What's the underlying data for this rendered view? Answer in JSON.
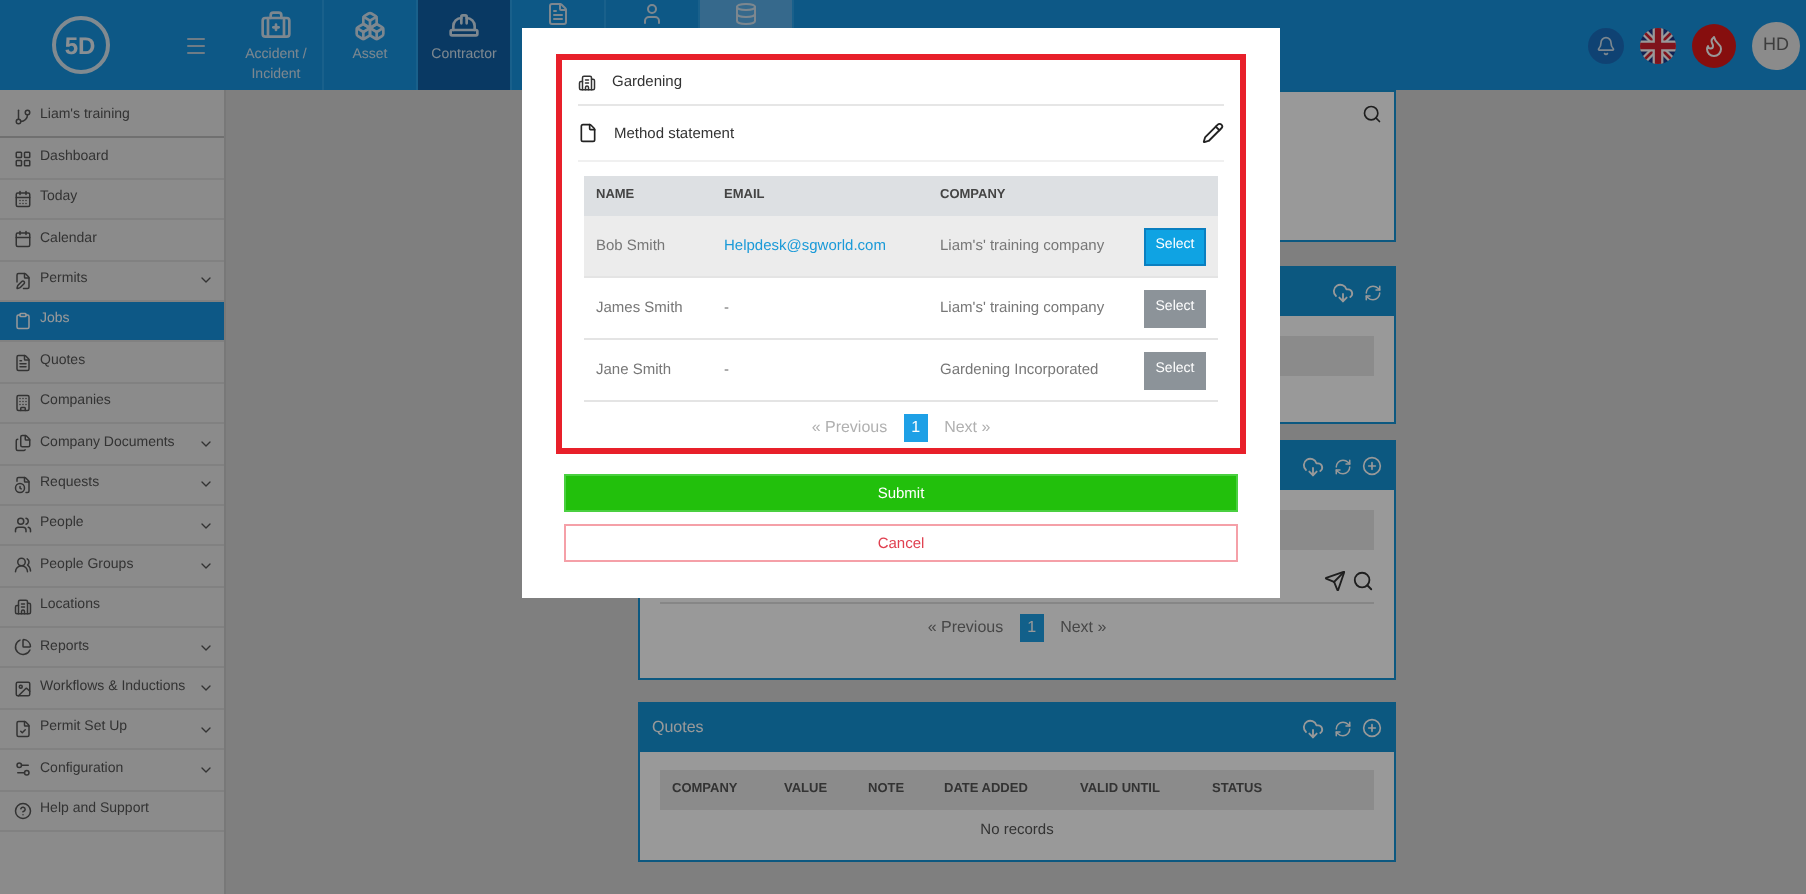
{
  "header": {
    "logo": "5D",
    "tabs": [
      {
        "label": "Accident / Incident",
        "selected": false
      },
      {
        "label": "Asset",
        "selected": false
      },
      {
        "label": "Contractor",
        "selected": true
      },
      {
        "selected": false
      },
      {
        "selected": false
      },
      {
        "selected": false
      }
    ],
    "avatar": "HD"
  },
  "sidebar": {
    "items": [
      {
        "label": "Liam's training",
        "expandable": false,
        "selected": false
      },
      {
        "label": "Dashboard",
        "expandable": false,
        "selected": false
      },
      {
        "label": "Today",
        "expandable": false,
        "selected": false
      },
      {
        "label": "Calendar",
        "expandable": false,
        "selected": false
      },
      {
        "label": "Permits",
        "expandable": true,
        "selected": false
      },
      {
        "label": "Jobs",
        "expandable": false,
        "selected": true
      },
      {
        "label": "Quotes",
        "expandable": false,
        "selected": false
      },
      {
        "label": "Companies",
        "expandable": false,
        "selected": false
      },
      {
        "label": "Company Documents",
        "expandable": true,
        "selected": false
      },
      {
        "label": "Requests",
        "expandable": true,
        "selected": false
      },
      {
        "label": "People",
        "expandable": true,
        "selected": false
      },
      {
        "label": "People Groups",
        "expandable": true,
        "selected": false
      },
      {
        "label": "Locations",
        "expandable": false,
        "selected": false
      },
      {
        "label": "Reports",
        "expandable": true,
        "selected": false
      },
      {
        "label": "Workflows & Inductions",
        "expandable": true,
        "selected": false
      },
      {
        "label": "Permit Set Up",
        "expandable": true,
        "selected": false
      },
      {
        "label": "Configuration",
        "expandable": true,
        "selected": false
      },
      {
        "label": "Help and Support",
        "expandable": false,
        "selected": false
      }
    ]
  },
  "background": {
    "pagination": {
      "previous": "« Previous",
      "pages": [
        {
          "label": "1",
          "selected": true
        }
      ],
      "next": "Next »"
    },
    "quotes": {
      "title": "Quotes",
      "columns": [
        "COMPANY",
        "VALUE",
        "NOTE",
        "DATE ADDED",
        "VALID UNTIL",
        "STATUS"
      ],
      "empty": "No records"
    }
  },
  "modal": {
    "item": "Gardening",
    "document": "Method statement",
    "columns": [
      "NAME",
      "EMAIL",
      "COMPANY"
    ],
    "rows": [
      {
        "name": "Bob Smith",
        "email": "Helpdesk@sgworld.com",
        "company": "Liam's' training company",
        "button": "Select",
        "selected": true
      },
      {
        "name": "James Smith",
        "email": "-",
        "company": "Liam's' training company",
        "button": "Select",
        "selected": false
      },
      {
        "name": "Jane Smith",
        "email": "-",
        "company": "Gardening Incorporated",
        "button": "Select",
        "selected": false
      }
    ],
    "pagination": {
      "previous": "« Previous",
      "pages": [
        {
          "label": "1",
          "selected": true
        }
      ],
      "next": "Next »"
    },
    "submit": "Submit",
    "cancel": "Cancel"
  }
}
